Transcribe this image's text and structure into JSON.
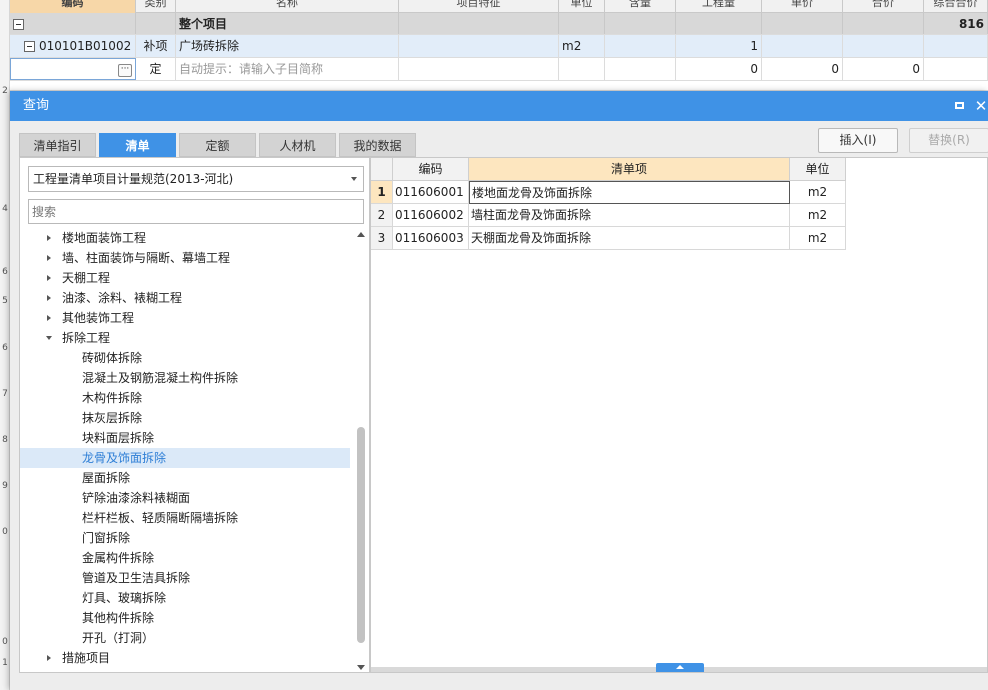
{
  "background_grid": {
    "headers": [
      "编码",
      "类别",
      "名称",
      "项目特征",
      "单位",
      "含量",
      "工程量",
      "单价",
      "合价",
      "综合合价"
    ],
    "total_row": {
      "label": "整个项目",
      "value": "816"
    },
    "item_row": {
      "code": "010101B01002",
      "type": "补项",
      "name": "广场砖拆除",
      "unit": "m2",
      "quantity": "1"
    },
    "def_row": {
      "type": "定",
      "hint": "自动提示：请输入子目简称",
      "quantity": "0",
      "price": "0",
      "total": "0"
    },
    "gutter_numbers": [
      "2",
      "4",
      "6",
      "5",
      "6",
      "7",
      "8",
      "9",
      "0",
      "0",
      "1"
    ]
  },
  "dialog": {
    "title": "查询",
    "tabs": [
      "清单指引",
      "清单",
      "定额",
      "人材机",
      "我的数据"
    ],
    "active_tab": 1,
    "insert_button": "插入(I)",
    "replace_button": "替换(R)",
    "standard_select": "工程量清单项目计量规范(2013-河北)",
    "search_placeholder": "搜索",
    "tree": [
      {
        "label": "楼地面装饰工程",
        "level": 1,
        "state": "collapsed"
      },
      {
        "label": "墙、柱面装饰与隔断、幕墙工程",
        "level": 1,
        "state": "collapsed"
      },
      {
        "label": "天棚工程",
        "level": 1,
        "state": "collapsed"
      },
      {
        "label": "油漆、涂料、裱糊工程",
        "level": 1,
        "state": "collapsed"
      },
      {
        "label": "其他装饰工程",
        "level": 1,
        "state": "collapsed"
      },
      {
        "label": "拆除工程",
        "level": 1,
        "state": "expanded"
      },
      {
        "label": "砖砌体拆除",
        "level": 2
      },
      {
        "label": "混凝土及钢筋混凝土构件拆除",
        "level": 2
      },
      {
        "label": "木构件拆除",
        "level": 2
      },
      {
        "label": "抹灰层拆除",
        "level": 2
      },
      {
        "label": "块料面层拆除",
        "level": 2
      },
      {
        "label": "龙骨及饰面拆除",
        "level": 2,
        "selected": true
      },
      {
        "label": "屋面拆除",
        "level": 2
      },
      {
        "label": "铲除油漆涂料裱糊面",
        "level": 2
      },
      {
        "label": "栏杆栏板、轻质隔断隔墙拆除",
        "level": 2
      },
      {
        "label": "门窗拆除",
        "level": 2
      },
      {
        "label": "金属构件拆除",
        "level": 2
      },
      {
        "label": "管道及卫生洁具拆除",
        "level": 2
      },
      {
        "label": "灯具、玻璃拆除",
        "level": 2
      },
      {
        "label": "其他构件拆除",
        "level": 2
      },
      {
        "label": "开孔（打洞）",
        "level": 2
      },
      {
        "label": "措施项目",
        "level": 1,
        "state": "collapsed"
      }
    ],
    "result_headers": [
      "",
      "编码",
      "清单项",
      "单位"
    ],
    "results": [
      {
        "no": "1",
        "code": "011606001",
        "name": "楼地面龙骨及饰面拆除",
        "unit": "m2"
      },
      {
        "no": "2",
        "code": "011606002",
        "name": "墙柱面龙骨及饰面拆除",
        "unit": "m2"
      },
      {
        "no": "3",
        "code": "011606003",
        "name": "天棚面龙骨及饰面拆除",
        "unit": "m2"
      }
    ]
  }
}
